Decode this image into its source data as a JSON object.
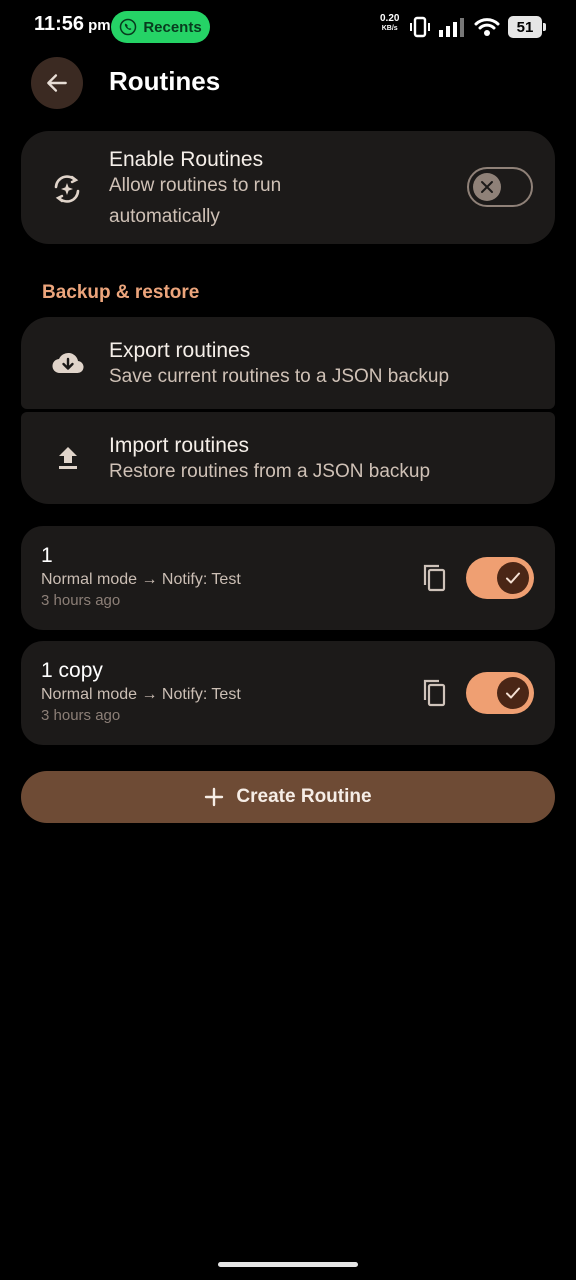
{
  "status_bar": {
    "time": "11:56",
    "ampm": "pm",
    "recents_label": "Recents",
    "net_speed_value": "0.20",
    "net_speed_unit": "KB/s",
    "battery": "51"
  },
  "header": {
    "title": "Routines"
  },
  "enable_routines": {
    "title": "Enable Routines",
    "subtitle_line1": "Allow routines to run",
    "subtitle_line2": "automatically",
    "enabled": false
  },
  "backup": {
    "section_label": "Backup & restore",
    "export_title": "Export routines",
    "export_subtitle": "Save current routines to a JSON backup",
    "import_title": "Import routines",
    "import_subtitle": "Restore routines from a JSON backup"
  },
  "routines": [
    {
      "name": "1",
      "description": "Normal mode → Notify: Test",
      "time": "3 hours ago",
      "enabled": true
    },
    {
      "name": "1 copy",
      "description": "Normal mode → Notify: Test",
      "time": "3 hours ago",
      "enabled": true
    }
  ],
  "create_button": {
    "label": "Create Routine"
  },
  "colors": {
    "accent": "#ef9f72",
    "card": "#1c1a19",
    "create_button": "#6e4b35",
    "section_label": "#eca57c"
  },
  "icons": {
    "back": "arrow-left-icon",
    "enable": "auto-refresh-sparkle-icon",
    "export": "cloud-download-icon",
    "import": "upload-icon",
    "copy": "copy-icon",
    "add": "plus-icon"
  }
}
